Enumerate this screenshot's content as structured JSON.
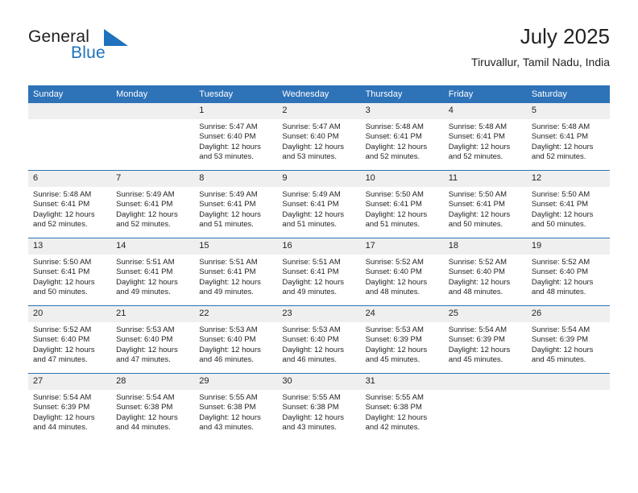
{
  "brand": {
    "name_top": "General",
    "name_bottom": "Blue",
    "flag_icon": "blue-triangle-flag-icon",
    "color_top": "#231f20",
    "color_bottom": "#1f72bd"
  },
  "header": {
    "title": "July 2025",
    "subtitle": "Tiruvallur, Tamil Nadu, India"
  },
  "theme": {
    "header_bg": "#2e72b8",
    "header_text": "#ffffff",
    "daynum_bg": "#efefef",
    "row_border": "#2e72b8",
    "body_text": "#231f20"
  },
  "weekdays": [
    "Sunday",
    "Monday",
    "Tuesday",
    "Wednesday",
    "Thursday",
    "Friday",
    "Saturday"
  ],
  "weeks": [
    [
      {
        "day": "",
        "sunrise": "",
        "sunset": "",
        "daylight_line1": "",
        "daylight_line2": ""
      },
      {
        "day": "",
        "sunrise": "",
        "sunset": "",
        "daylight_line1": "",
        "daylight_line2": ""
      },
      {
        "day": "1",
        "sunrise": "Sunrise: 5:47 AM",
        "sunset": "Sunset: 6:40 PM",
        "daylight_line1": "Daylight: 12 hours",
        "daylight_line2": "and 53 minutes."
      },
      {
        "day": "2",
        "sunrise": "Sunrise: 5:47 AM",
        "sunset": "Sunset: 6:40 PM",
        "daylight_line1": "Daylight: 12 hours",
        "daylight_line2": "and 53 minutes."
      },
      {
        "day": "3",
        "sunrise": "Sunrise: 5:48 AM",
        "sunset": "Sunset: 6:41 PM",
        "daylight_line1": "Daylight: 12 hours",
        "daylight_line2": "and 52 minutes."
      },
      {
        "day": "4",
        "sunrise": "Sunrise: 5:48 AM",
        "sunset": "Sunset: 6:41 PM",
        "daylight_line1": "Daylight: 12 hours",
        "daylight_line2": "and 52 minutes."
      },
      {
        "day": "5",
        "sunrise": "Sunrise: 5:48 AM",
        "sunset": "Sunset: 6:41 PM",
        "daylight_line1": "Daylight: 12 hours",
        "daylight_line2": "and 52 minutes."
      }
    ],
    [
      {
        "day": "6",
        "sunrise": "Sunrise: 5:48 AM",
        "sunset": "Sunset: 6:41 PM",
        "daylight_line1": "Daylight: 12 hours",
        "daylight_line2": "and 52 minutes."
      },
      {
        "day": "7",
        "sunrise": "Sunrise: 5:49 AM",
        "sunset": "Sunset: 6:41 PM",
        "daylight_line1": "Daylight: 12 hours",
        "daylight_line2": "and 52 minutes."
      },
      {
        "day": "8",
        "sunrise": "Sunrise: 5:49 AM",
        "sunset": "Sunset: 6:41 PM",
        "daylight_line1": "Daylight: 12 hours",
        "daylight_line2": "and 51 minutes."
      },
      {
        "day": "9",
        "sunrise": "Sunrise: 5:49 AM",
        "sunset": "Sunset: 6:41 PM",
        "daylight_line1": "Daylight: 12 hours",
        "daylight_line2": "and 51 minutes."
      },
      {
        "day": "10",
        "sunrise": "Sunrise: 5:50 AM",
        "sunset": "Sunset: 6:41 PM",
        "daylight_line1": "Daylight: 12 hours",
        "daylight_line2": "and 51 minutes."
      },
      {
        "day": "11",
        "sunrise": "Sunrise: 5:50 AM",
        "sunset": "Sunset: 6:41 PM",
        "daylight_line1": "Daylight: 12 hours",
        "daylight_line2": "and 50 minutes."
      },
      {
        "day": "12",
        "sunrise": "Sunrise: 5:50 AM",
        "sunset": "Sunset: 6:41 PM",
        "daylight_line1": "Daylight: 12 hours",
        "daylight_line2": "and 50 minutes."
      }
    ],
    [
      {
        "day": "13",
        "sunrise": "Sunrise: 5:50 AM",
        "sunset": "Sunset: 6:41 PM",
        "daylight_line1": "Daylight: 12 hours",
        "daylight_line2": "and 50 minutes."
      },
      {
        "day": "14",
        "sunrise": "Sunrise: 5:51 AM",
        "sunset": "Sunset: 6:41 PM",
        "daylight_line1": "Daylight: 12 hours",
        "daylight_line2": "and 49 minutes."
      },
      {
        "day": "15",
        "sunrise": "Sunrise: 5:51 AM",
        "sunset": "Sunset: 6:41 PM",
        "daylight_line1": "Daylight: 12 hours",
        "daylight_line2": "and 49 minutes."
      },
      {
        "day": "16",
        "sunrise": "Sunrise: 5:51 AM",
        "sunset": "Sunset: 6:41 PM",
        "daylight_line1": "Daylight: 12 hours",
        "daylight_line2": "and 49 minutes."
      },
      {
        "day": "17",
        "sunrise": "Sunrise: 5:52 AM",
        "sunset": "Sunset: 6:40 PM",
        "daylight_line1": "Daylight: 12 hours",
        "daylight_line2": "and 48 minutes."
      },
      {
        "day": "18",
        "sunrise": "Sunrise: 5:52 AM",
        "sunset": "Sunset: 6:40 PM",
        "daylight_line1": "Daylight: 12 hours",
        "daylight_line2": "and 48 minutes."
      },
      {
        "day": "19",
        "sunrise": "Sunrise: 5:52 AM",
        "sunset": "Sunset: 6:40 PM",
        "daylight_line1": "Daylight: 12 hours",
        "daylight_line2": "and 48 minutes."
      }
    ],
    [
      {
        "day": "20",
        "sunrise": "Sunrise: 5:52 AM",
        "sunset": "Sunset: 6:40 PM",
        "daylight_line1": "Daylight: 12 hours",
        "daylight_line2": "and 47 minutes."
      },
      {
        "day": "21",
        "sunrise": "Sunrise: 5:53 AM",
        "sunset": "Sunset: 6:40 PM",
        "daylight_line1": "Daylight: 12 hours",
        "daylight_line2": "and 47 minutes."
      },
      {
        "day": "22",
        "sunrise": "Sunrise: 5:53 AM",
        "sunset": "Sunset: 6:40 PM",
        "daylight_line1": "Daylight: 12 hours",
        "daylight_line2": "and 46 minutes."
      },
      {
        "day": "23",
        "sunrise": "Sunrise: 5:53 AM",
        "sunset": "Sunset: 6:40 PM",
        "daylight_line1": "Daylight: 12 hours",
        "daylight_line2": "and 46 minutes."
      },
      {
        "day": "24",
        "sunrise": "Sunrise: 5:53 AM",
        "sunset": "Sunset: 6:39 PM",
        "daylight_line1": "Daylight: 12 hours",
        "daylight_line2": "and 45 minutes."
      },
      {
        "day": "25",
        "sunrise": "Sunrise: 5:54 AM",
        "sunset": "Sunset: 6:39 PM",
        "daylight_line1": "Daylight: 12 hours",
        "daylight_line2": "and 45 minutes."
      },
      {
        "day": "26",
        "sunrise": "Sunrise: 5:54 AM",
        "sunset": "Sunset: 6:39 PM",
        "daylight_line1": "Daylight: 12 hours",
        "daylight_line2": "and 45 minutes."
      }
    ],
    [
      {
        "day": "27",
        "sunrise": "Sunrise: 5:54 AM",
        "sunset": "Sunset: 6:39 PM",
        "daylight_line1": "Daylight: 12 hours",
        "daylight_line2": "and 44 minutes."
      },
      {
        "day": "28",
        "sunrise": "Sunrise: 5:54 AM",
        "sunset": "Sunset: 6:38 PM",
        "daylight_line1": "Daylight: 12 hours",
        "daylight_line2": "and 44 minutes."
      },
      {
        "day": "29",
        "sunrise": "Sunrise: 5:55 AM",
        "sunset": "Sunset: 6:38 PM",
        "daylight_line1": "Daylight: 12 hours",
        "daylight_line2": "and 43 minutes."
      },
      {
        "day": "30",
        "sunrise": "Sunrise: 5:55 AM",
        "sunset": "Sunset: 6:38 PM",
        "daylight_line1": "Daylight: 12 hours",
        "daylight_line2": "and 43 minutes."
      },
      {
        "day": "31",
        "sunrise": "Sunrise: 5:55 AM",
        "sunset": "Sunset: 6:38 PM",
        "daylight_line1": "Daylight: 12 hours",
        "daylight_line2": "and 42 minutes."
      },
      {
        "day": "",
        "sunrise": "",
        "sunset": "",
        "daylight_line1": "",
        "daylight_line2": ""
      },
      {
        "day": "",
        "sunrise": "",
        "sunset": "",
        "daylight_line1": "",
        "daylight_line2": ""
      }
    ]
  ]
}
